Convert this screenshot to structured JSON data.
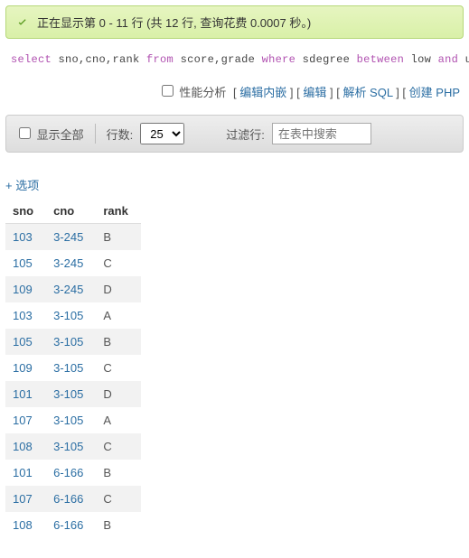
{
  "success_message": "正在显示第 0 - 11 行 (共 12 行, 查询花费 0.0007 秒。)",
  "sql": {
    "p1": "select",
    "p2": " sno,cno,rank ",
    "p3": "from",
    "p4": " score,grade ",
    "p5": "where",
    "p6": " sdegree ",
    "p7": "between",
    "p8": " low ",
    "p9": "and",
    "p10": " upp"
  },
  "links": {
    "perf": "性能分析",
    "edit_inline": "编辑内嵌",
    "edit": "编辑",
    "explain": "解析 SQL",
    "create_php": "创建 PHP"
  },
  "toolbar": {
    "show_all": "显示全部",
    "rows_label": "行数:",
    "rows_value": "25",
    "filter_label": "过滤行:",
    "filter_placeholder": "在表中搜索"
  },
  "options_link": "+ 选项",
  "table": {
    "headers": {
      "c0": "sno",
      "c1": "cno",
      "c2": "rank"
    },
    "rows": [
      {
        "sno": "103",
        "cno": "3-245",
        "rank": "B"
      },
      {
        "sno": "105",
        "cno": "3-245",
        "rank": "C"
      },
      {
        "sno": "109",
        "cno": "3-245",
        "rank": "D"
      },
      {
        "sno": "103",
        "cno": "3-105",
        "rank": "A"
      },
      {
        "sno": "105",
        "cno": "3-105",
        "rank": "B"
      },
      {
        "sno": "109",
        "cno": "3-105",
        "rank": "C"
      },
      {
        "sno": "101",
        "cno": "3-105",
        "rank": "D"
      },
      {
        "sno": "107",
        "cno": "3-105",
        "rank": "A"
      },
      {
        "sno": "108",
        "cno": "3-105",
        "rank": "C"
      },
      {
        "sno": "101",
        "cno": "6-166",
        "rank": "B"
      },
      {
        "sno": "107",
        "cno": "6-166",
        "rank": "C"
      },
      {
        "sno": "108",
        "cno": "6-166",
        "rank": "B"
      }
    ]
  }
}
